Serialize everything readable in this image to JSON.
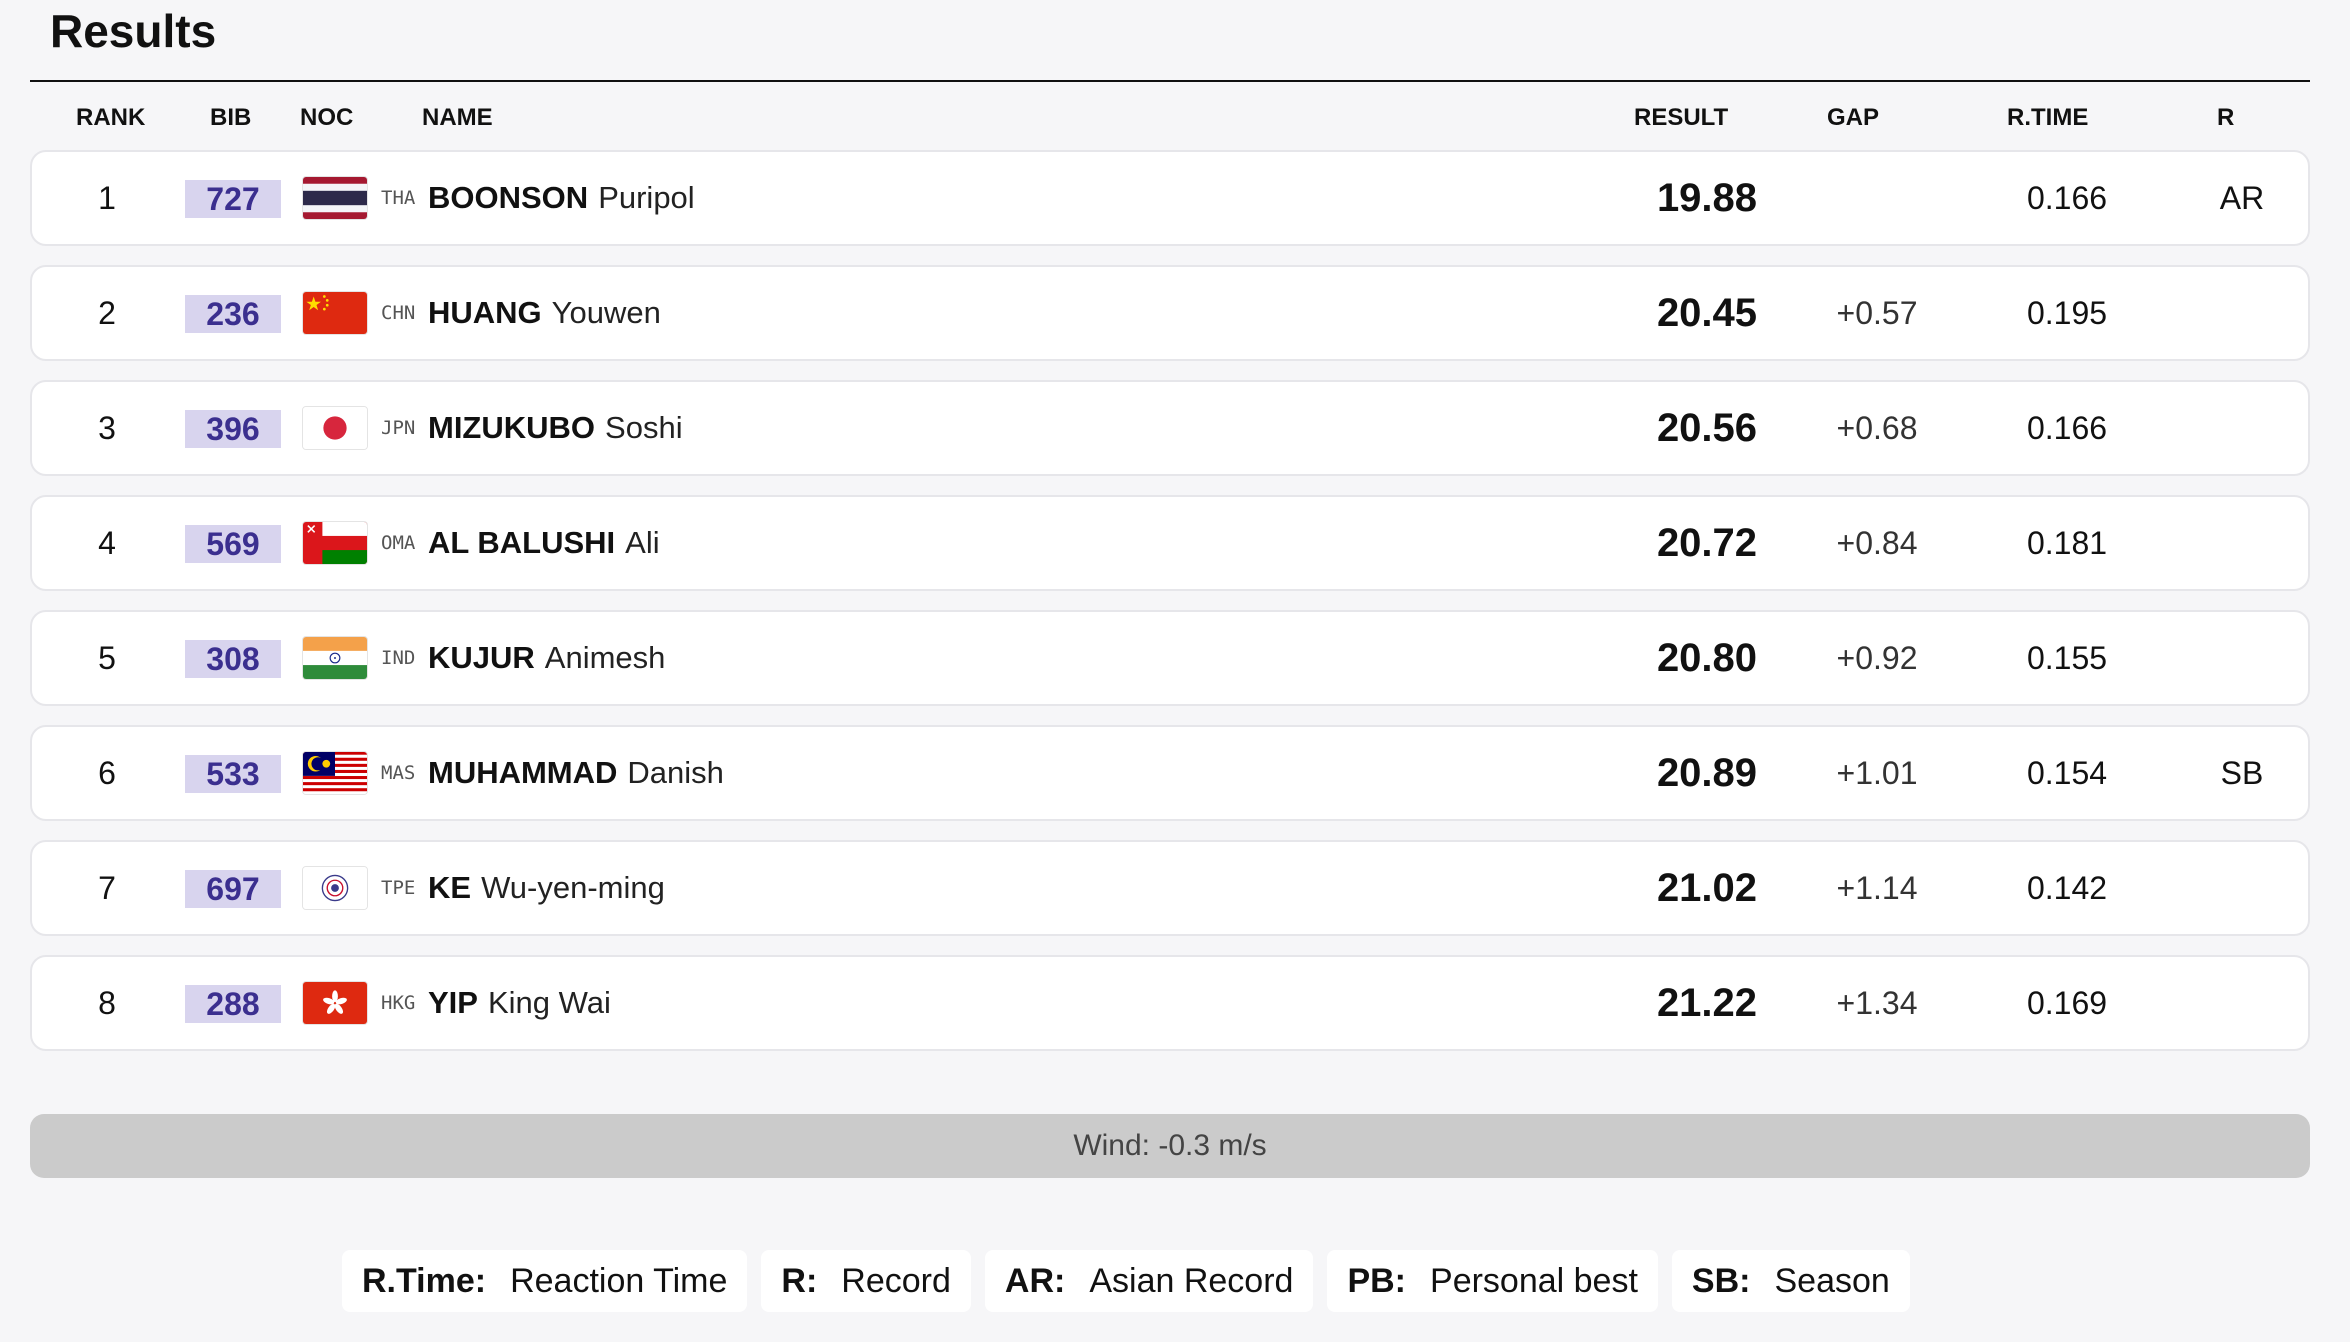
{
  "page": {
    "title": "Results"
  },
  "columns": {
    "rank": "RANK",
    "bib": "BIB",
    "noc": "NOC",
    "name": "NAME",
    "result": "RESULT",
    "gap": "GAP",
    "rtime": "R.TIME",
    "r": "R"
  },
  "rows": [
    {
      "rank": "1",
      "bib": "727",
      "noc": "THA",
      "last": "BOONSON",
      "first": "Puripol",
      "result": "19.88",
      "gap": "",
      "rtime": "0.166",
      "record": "AR",
      "flag": "thailand-flag"
    },
    {
      "rank": "2",
      "bib": "236",
      "noc": "CHN",
      "last": "HUANG",
      "first": "Youwen",
      "result": "20.45",
      "gap": "+0.57",
      "rtime": "0.195",
      "record": "",
      "flag": "china-flag"
    },
    {
      "rank": "3",
      "bib": "396",
      "noc": "JPN",
      "last": "MIZUKUBO",
      "first": "Soshi",
      "result": "20.56",
      "gap": "+0.68",
      "rtime": "0.166",
      "record": "",
      "flag": "japan-flag"
    },
    {
      "rank": "4",
      "bib": "569",
      "noc": "OMA",
      "last": "AL BALUSHI",
      "first": "Ali",
      "result": "20.72",
      "gap": "+0.84",
      "rtime": "0.181",
      "record": "",
      "flag": "oman-flag"
    },
    {
      "rank": "5",
      "bib": "308",
      "noc": "IND",
      "last": "KUJUR",
      "first": "Animesh",
      "result": "20.80",
      "gap": "+0.92",
      "rtime": "0.155",
      "record": "",
      "flag": "india-flag"
    },
    {
      "rank": "6",
      "bib": "533",
      "noc": "MAS",
      "last": "MUHAMMAD",
      "first": "Danish",
      "result": "20.89",
      "gap": "+1.01",
      "rtime": "0.154",
      "record": "SB",
      "flag": "malaysia-flag"
    },
    {
      "rank": "7",
      "bib": "697",
      "noc": "TPE",
      "last": "KE",
      "first": "Wu-yen-ming",
      "result": "21.02",
      "gap": "+1.14",
      "rtime": "0.142",
      "record": "",
      "flag": "chinese-taipei-flag"
    },
    {
      "rank": "8",
      "bib": "288",
      "noc": "HKG",
      "last": "YIP",
      "first": "King Wai",
      "result": "21.22",
      "gap": "+1.34",
      "rtime": "0.169",
      "record": "",
      "flag": "hong-kong-flag"
    }
  ],
  "wind": "Wind: -0.3 m/s",
  "legend": [
    {
      "key": "R.Time:",
      "value": "Reaction Time"
    },
    {
      "key": "R:",
      "value": "Record"
    },
    {
      "key": "AR:",
      "value": "Asian Record"
    },
    {
      "key": "PB:",
      "value": "Personal best"
    },
    {
      "key": "SB:",
      "value": "Season"
    }
  ],
  "colors": {
    "bib_bg": "#d8d4ee",
    "bib_text": "#3b2f8f",
    "wind_bg": "#cbcbcb"
  }
}
